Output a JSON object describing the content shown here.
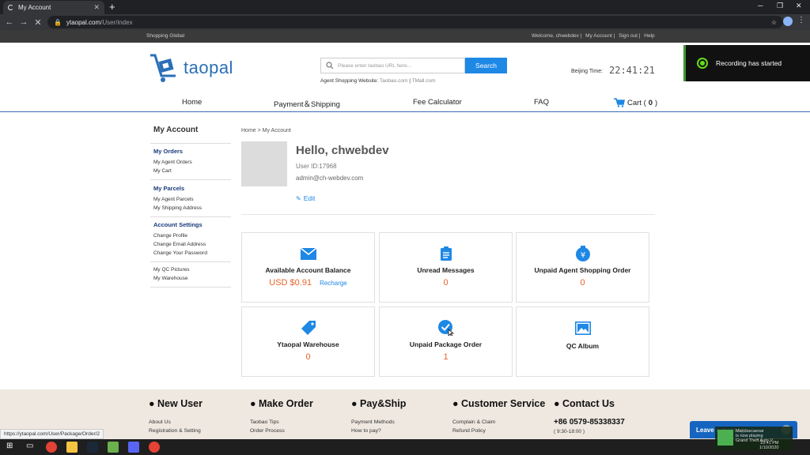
{
  "browser": {
    "tab_title": "My Account",
    "new_tab": "+",
    "url_host": "ytaopal.com",
    "url_path": "/User/index",
    "status_url": "https://ytaopal.com/User/Package/Order/2"
  },
  "sitebar": {
    "left": "Shopping Global",
    "welcome": "Welcome, chwebdev |",
    "my_account": "My Account |",
    "sign_out": "Sign out |",
    "help": "Help"
  },
  "header": {
    "logo_text": "taopal",
    "search_placeholder": "Please enter taobao URL here...",
    "search_button": "Search",
    "agent_label": "Agent Shopping Website:",
    "agent_taobao": "Taobao.com",
    "agent_sep": "|",
    "agent_tmall": "TMall.com",
    "beijing_label": "Beijing Time:",
    "beijing_time": "22:41:21"
  },
  "recording": {
    "text": "Recording has started"
  },
  "nav": {
    "home": "Home",
    "payment": "Payment＆Shipping",
    "fee": "Fee Calculator",
    "faq": "FAQ",
    "cart_label": "Cart (",
    "cart_count": "0",
    "cart_close": ")"
  },
  "sidebar": {
    "title": "My Account",
    "orders_heading": "My Orders",
    "agent_orders": "My Agent Orders",
    "cart": "My Cart",
    "parcels_heading": "My Parcels",
    "agent_parcels": "My Agent Parcels",
    "shipping_address": "My Shipping Address",
    "settings_heading": "Account Settings",
    "change_profile": "Change Profile",
    "change_email": "Change Email Address",
    "change_password": "Change Your Password",
    "qc_pictures": "My QC Pictures",
    "warehouse": "My Warehouse"
  },
  "main": {
    "breadcrumb": "Home > My Account",
    "hello": "Hello, chwebdev",
    "user_id": "User ID:17968",
    "email": "admin@ch-webdev.com",
    "edit": "Edit"
  },
  "cards": {
    "balance_title": "Available Account Balance",
    "balance_value": "USD $0.91",
    "recharge": "Recharge",
    "messages_title": "Unread Messages",
    "messages_value": "0",
    "unpaid_agent_title": "Unpaid Agent Shopping Order",
    "unpaid_agent_value": "0",
    "warehouse_title": "Ytaopal Warehouse",
    "warehouse_value": "0",
    "unpaid_package_title": "Unpaid Package Order",
    "unpaid_package_value": "1",
    "qc_title": "QC Album"
  },
  "footer": {
    "new_user": "● New User",
    "make_order": "● Make Order",
    "pay_ship": "● Pay&Ship",
    "customer_service": "● Customer Service",
    "contact_us": "● Contact Us",
    "about_us": "About Us",
    "registration": "Registration & Setting",
    "taobao_tips": "Taobao Tips",
    "order_process": "Order Process",
    "payment_methods": "Payment Methods",
    "how_to_pay": "How to pay?",
    "complain": "Complain & Claim",
    "refund": "Refund Policy",
    "phone": "+86 0579-85338337",
    "hours": "( 9:30-18:00 )",
    "leave_message": "Leave a message"
  },
  "taskbar": {
    "notif_line1": "Marciuscaesar",
    "notif_line2": "is now playing",
    "notif_line3": "Grand Theft Auto V",
    "time": "10:41 PM",
    "date": "1/10/2020"
  },
  "colors": {
    "accent": "#1e88e5",
    "value": "#e8632b",
    "brand": "#2a6fb8"
  }
}
